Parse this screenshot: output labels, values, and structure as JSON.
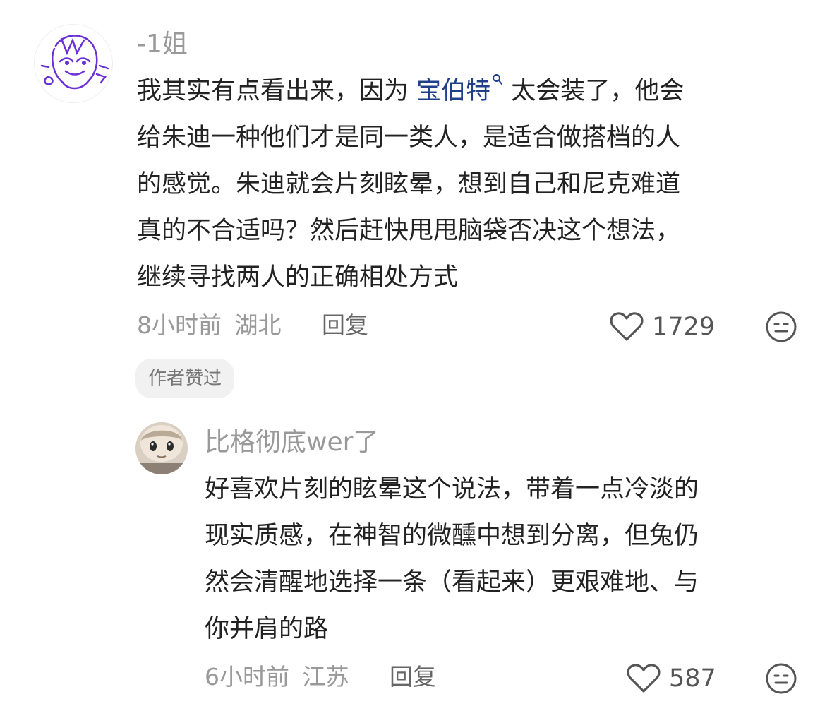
{
  "comments": [
    {
      "username": "-1姐",
      "text_lines": [
        [
          "我其实有点看出来，因为 ",
          "宝伯特",
          " 太会装了，他会"
        ],
        "给朱迪一种他们才是同一类人，是适合做搭档的人",
        "的感觉。朱迪就会片刻眩晕，想到自己和尼克难道",
        "真的不合适吗？然后赶快甩甩脑袋否决这个想法，",
        "继续寻找两人的正确相处方式"
      ],
      "time": "8小时前",
      "location": "湖北",
      "reply_label": "回复",
      "likes": "1729",
      "badge": "作者赞过",
      "icons": {
        "search_superscript": "search-icon",
        "like": "heart-outline-icon",
        "dislike": "meh-face-icon"
      }
    },
    {
      "username": "比格彻底wer了",
      "text_lines": [
        "好喜欢片刻的眩晕这个说法，带着一点冷淡的",
        "现实质感，在神智的微醺中想到分离，但兔仍",
        "然会清醒地选择一条（看起来）更艰难地、与",
        "你并肩的路"
      ],
      "time": "6小时前",
      "location": "江苏",
      "reply_label": "回复",
      "likes": "587",
      "icons": {
        "like": "heart-outline-icon",
        "dislike": "meh-face-icon"
      }
    }
  ],
  "colors": {
    "username": "#999999",
    "body_text": "#222222",
    "meta": "#999999",
    "link": "#1f3f8a",
    "badge_bg": "#f1f1f1",
    "avatar_purple": "#6b2fd6"
  }
}
